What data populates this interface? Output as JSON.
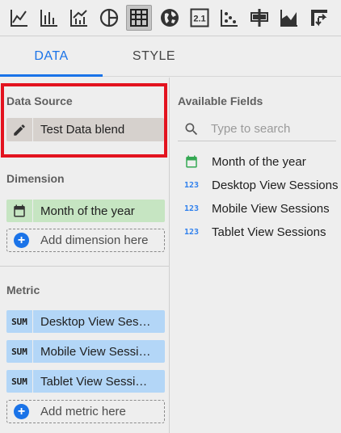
{
  "toolbar": {
    "icons": [
      {
        "name": "time-series-chart-icon"
      },
      {
        "name": "bar-chart-icon"
      },
      {
        "name": "combo-chart-icon"
      },
      {
        "name": "pie-chart-icon"
      },
      {
        "name": "table-chart-icon",
        "selected": true
      },
      {
        "name": "geo-map-icon"
      },
      {
        "name": "scorecard-icon",
        "text": "2.1"
      },
      {
        "name": "scatter-chart-icon"
      },
      {
        "name": "bullet-chart-icon"
      },
      {
        "name": "area-chart-icon"
      },
      {
        "name": "pivot-table-icon"
      }
    ]
  },
  "tabs": {
    "data_label": "DATA",
    "style_label": "STYLE",
    "active": "DATA"
  },
  "left": {
    "data_source": {
      "title": "Data Source",
      "value": "Test Data blend"
    },
    "dimension": {
      "title": "Dimension",
      "items": [
        {
          "label": "Month of the year"
        }
      ],
      "add_label": "Add dimension here"
    },
    "metric": {
      "title": "Metric",
      "items": [
        {
          "tag": "SUM",
          "label": "Desktop View Ses…"
        },
        {
          "tag": "SUM",
          "label": "Mobile View Sessi…"
        },
        {
          "tag": "SUM",
          "label": "Tablet View Sessi…"
        }
      ],
      "add_label": "Add metric here"
    }
  },
  "right": {
    "title": "Available Fields",
    "search": {
      "placeholder": "Type to search",
      "value": ""
    },
    "fields": [
      {
        "type": "date",
        "label": "Month of the year"
      },
      {
        "type": "number",
        "icon_text": "123",
        "label": "Desktop View Sessions"
      },
      {
        "type": "number",
        "icon_text": "123",
        "label": "Mobile View Sessions"
      },
      {
        "type": "number",
        "icon_text": "123",
        "label": "Tablet View Sessions"
      }
    ]
  },
  "colors": {
    "accent": "#1a73e8",
    "highlight": "#e3131f",
    "dimension_chip": "#c6e5c2",
    "metric_chip": "#b3d6f7",
    "date_icon": "#34a853"
  }
}
